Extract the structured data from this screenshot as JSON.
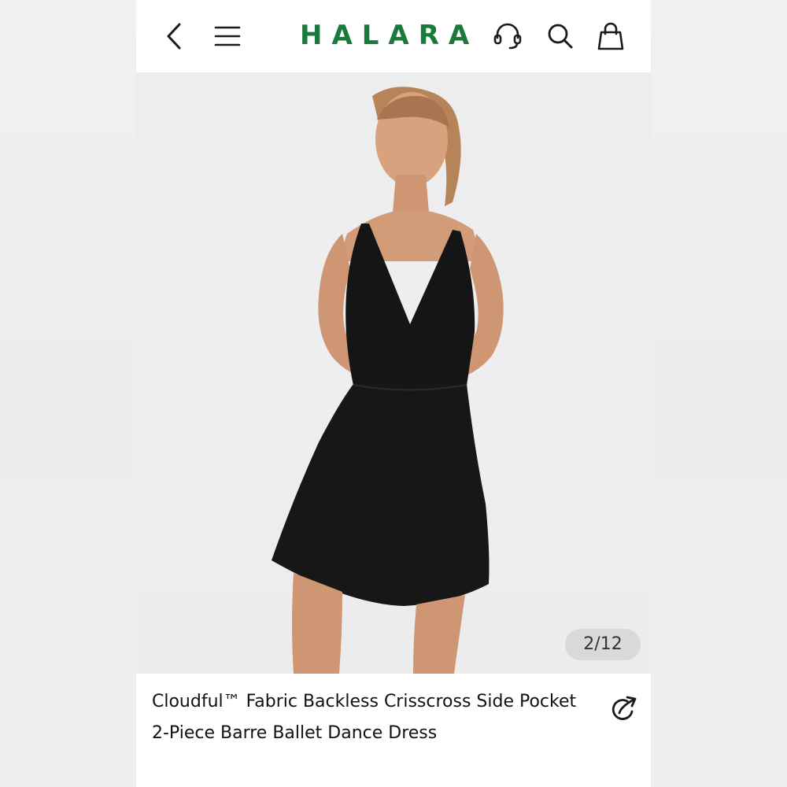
{
  "header": {
    "brand": "HALARA",
    "back_icon": "chevron-left-icon",
    "menu_icon": "hamburger-menu-icon",
    "support_icon": "headset-icon",
    "search_icon": "search-icon",
    "bag_icon": "shopping-bag-icon"
  },
  "gallery": {
    "counter": "2/12",
    "image_subject": "model-in-black-dress"
  },
  "product": {
    "title": "Cloudful™ Fabric Backless Crisscross Side Pocket 2-Piece Barre Ballet Dance Dress",
    "share_icon": "share-icon"
  },
  "colors": {
    "brand_green": "#1a7a3b",
    "badge_bg": "#d9d9d9",
    "dress": "#151515"
  }
}
